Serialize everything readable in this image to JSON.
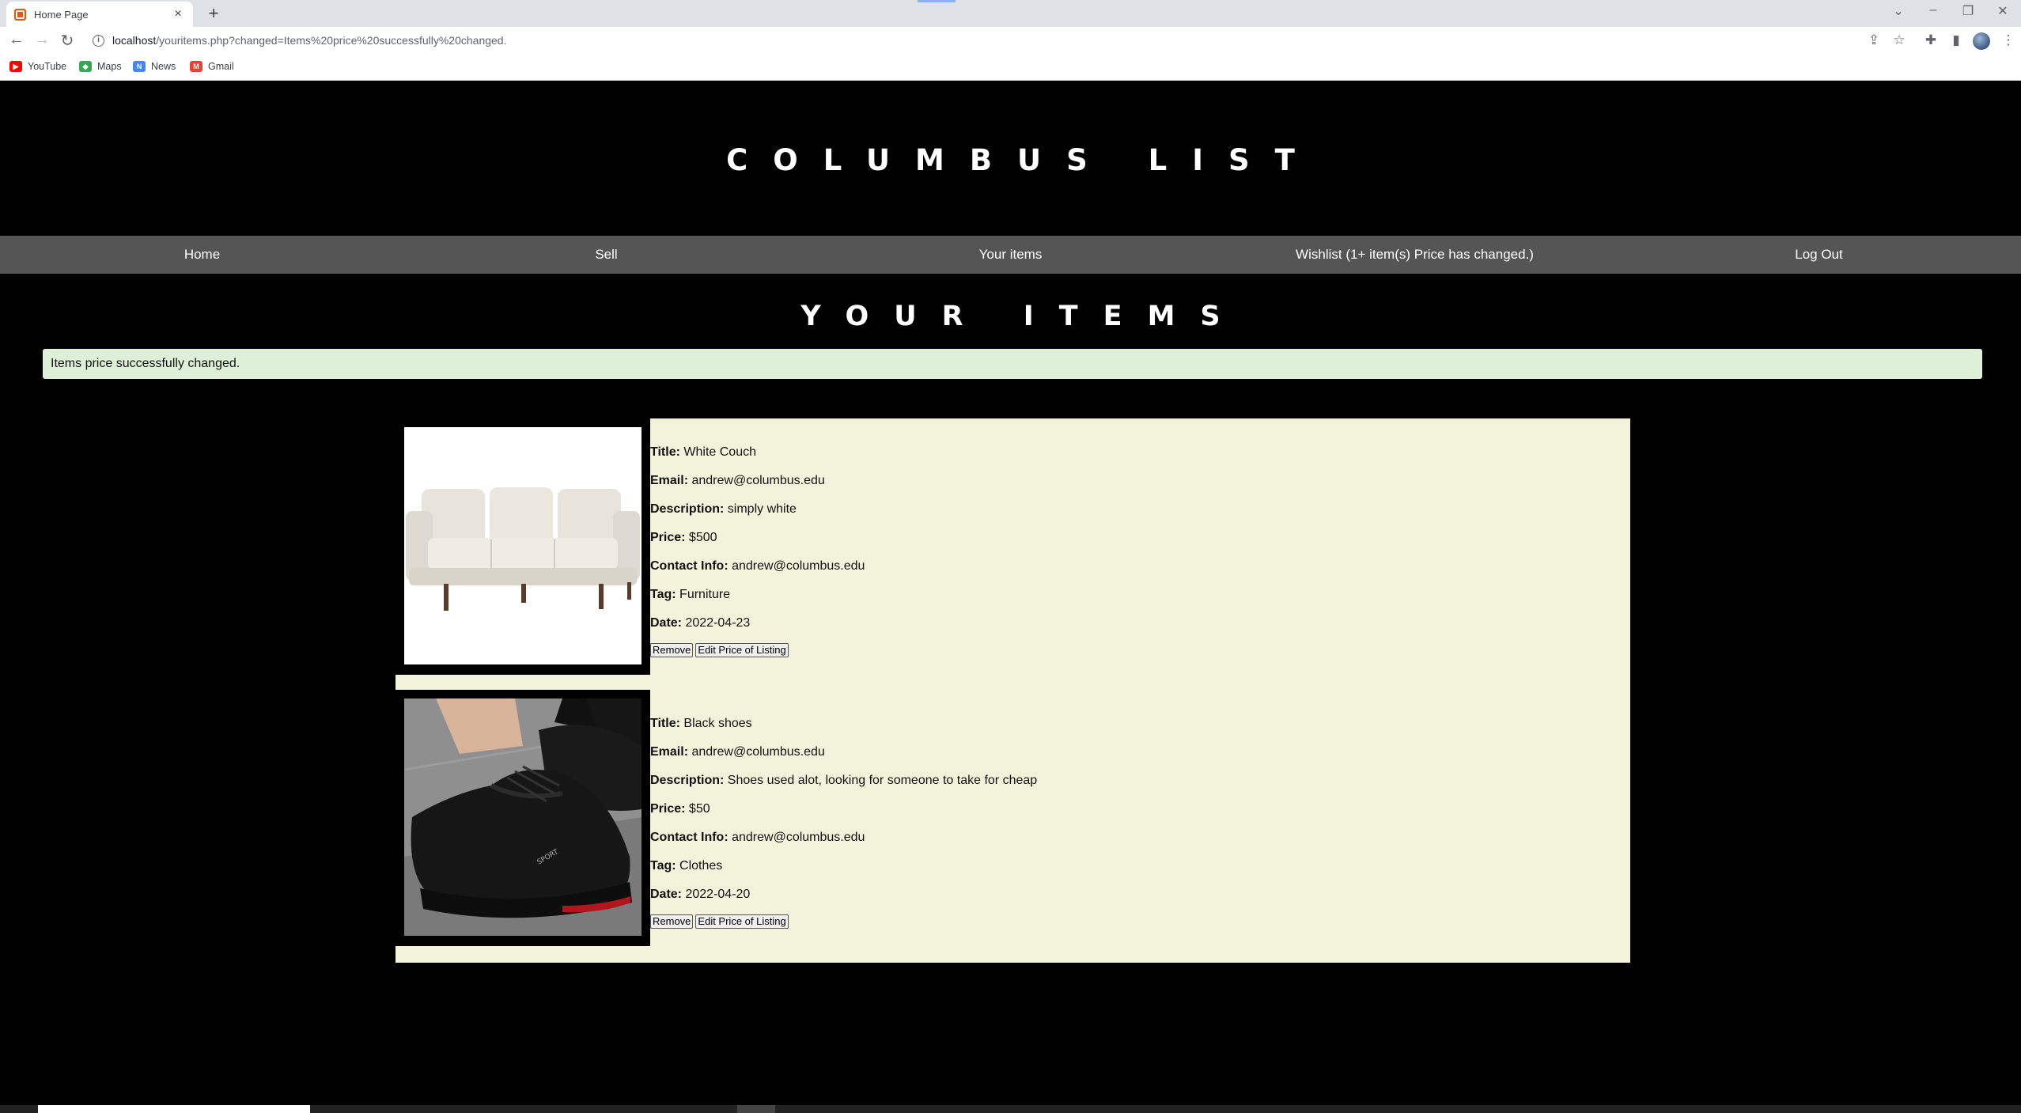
{
  "browser": {
    "tab_title": "Home Page",
    "url_host": "localhost",
    "url_path": "/youritems.php?changed=Items%20price%20successfully%20changed.",
    "bookmarks": [
      "YouTube",
      "Maps",
      "News",
      "Gmail"
    ]
  },
  "site": {
    "title": "COLUMBUS LIST"
  },
  "nav": {
    "items": [
      "Home",
      "Sell",
      "Your items",
      "Wishlist (1+ item(s) Price has changed.)",
      "Log Out"
    ]
  },
  "section": {
    "title": "YOUR ITEMS"
  },
  "alert": {
    "message": "Items price successfully changed."
  },
  "labels": {
    "title": "Title:",
    "email": "Email:",
    "description": "Description:",
    "price": "Price:",
    "contact": "Contact Info:",
    "tag": "Tag:",
    "date": "Date:",
    "remove": "Remove",
    "edit_price": "Edit Price of Listing"
  },
  "items": [
    {
      "title": "White Couch",
      "email": "andrew@columbus.edu",
      "description": "simply white",
      "price": "$500",
      "contact": "andrew@columbus.edu",
      "tag": "Furniture",
      "date": "2022-04-23"
    },
    {
      "title": "Black shoes",
      "email": "andrew@columbus.edu",
      "description": "Shoes used alot, looking for someone to take for cheap",
      "price": "$50",
      "contact": "andrew@columbus.edu",
      "tag": "Clothes",
      "date": "2022-04-20"
    }
  ]
}
